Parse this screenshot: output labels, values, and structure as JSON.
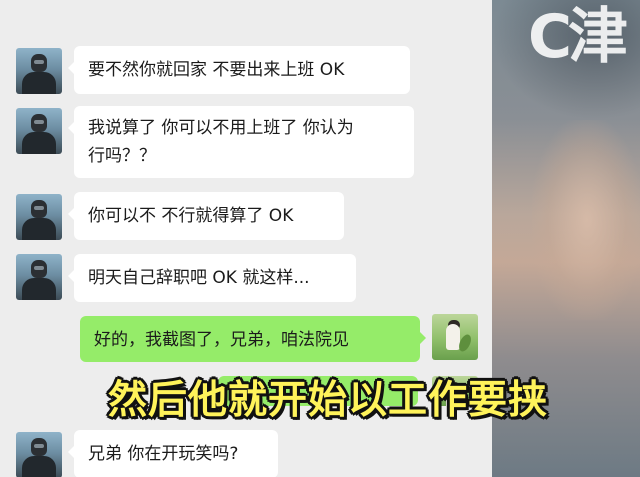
{
  "watermark": "C津",
  "caption": "然后他就开始以工作要挟",
  "messages": [
    {
      "side": "left",
      "text": "要不然你就回家 不要出来上班 OK"
    },
    {
      "side": "left",
      "text_lines": [
        "我说算了 你可以不用上班了 你认为",
        "行吗？？"
      ]
    },
    {
      "side": "left",
      "text": "你可以不 不行就得算了 OK"
    },
    {
      "side": "left",
      "text": "明天自己辞职吧 OK 就这样..."
    },
    {
      "side": "right",
      "text": "好的，我截图了，兄弟，咱法院见"
    },
    {
      "side": "left",
      "text": "兄弟 你在开玩笑吗?"
    }
  ],
  "colors": {
    "chat_bg": "#ededed",
    "bubble_left": "#ffffff",
    "bubble_right": "#95ec69",
    "caption": "#fff35a"
  }
}
